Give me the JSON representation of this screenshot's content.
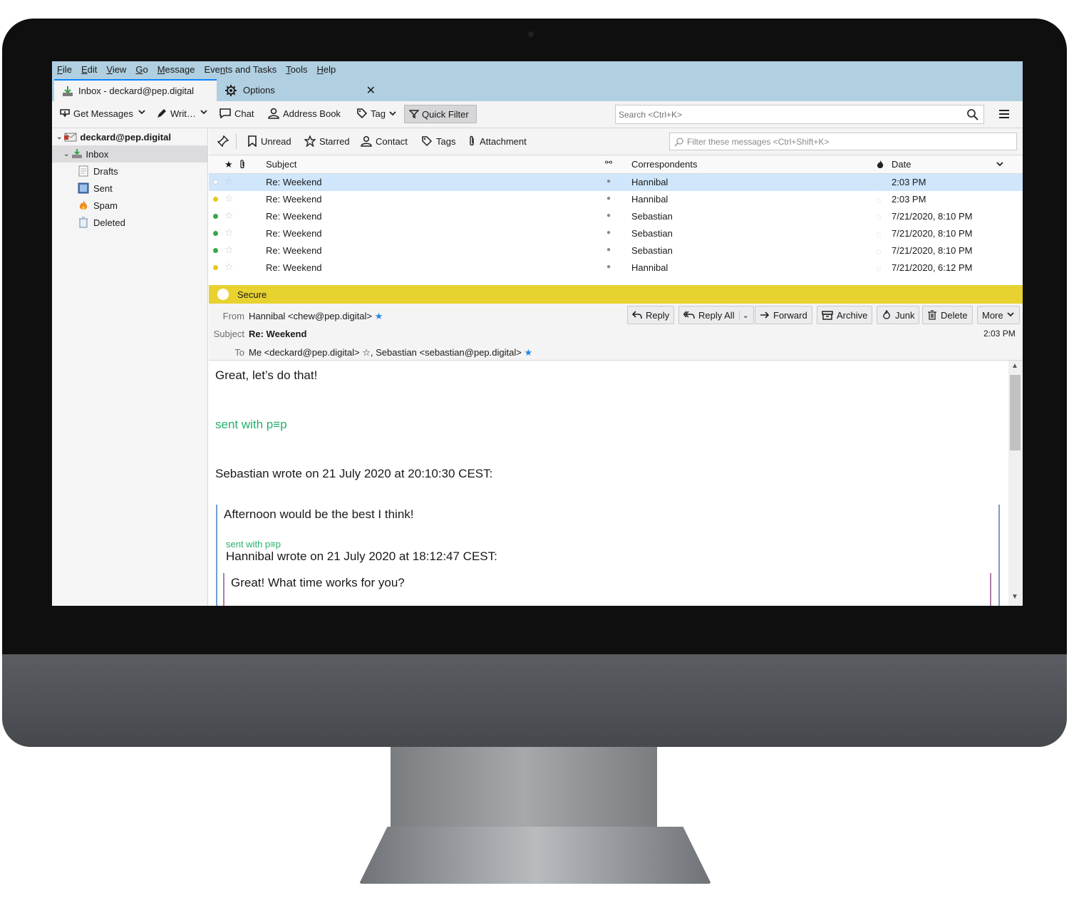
{
  "menu": [
    "File",
    "Edit",
    "View",
    "Go",
    "Message",
    "Events and Tasks",
    "Tools",
    "Help"
  ],
  "menu_access_letters": [
    "F",
    "E",
    "V",
    "G",
    "M",
    "n",
    "T",
    "H"
  ],
  "tabs": [
    {
      "label": "Inbox - deckard@pep.digital",
      "icon": "inbox-download-icon",
      "active": true
    },
    {
      "label": "Options",
      "icon": "gear-icon",
      "active": false
    }
  ],
  "toolbar": {
    "get_messages": "Get Messages",
    "write": "Writ…",
    "chat": "Chat",
    "address_book": "Address Book",
    "tag": "Tag",
    "quick_filter": "Quick Filter",
    "search_placeholder": "Search <Ctrl+K>"
  },
  "folders": {
    "account": "deckard@pep.digital",
    "items": [
      "Inbox",
      "Drafts",
      "Sent",
      "Spam",
      "Deleted"
    ]
  },
  "quick_filter_bar": {
    "unread": "Unread",
    "starred": "Starred",
    "contact": "Contact",
    "tags": "Tags",
    "attachment": "Attachment",
    "filter_placeholder": "Filter these messages <Ctrl+Shift+K>"
  },
  "columns": {
    "subject": "Subject",
    "correspondents": "Correspondents",
    "date": "Date"
  },
  "messages": [
    {
      "subject": "Re: Weekend",
      "correspondent": "Hannibal",
      "date": "2:03 PM",
      "status": "#ffffff",
      "selected": true
    },
    {
      "subject": "Re: Weekend",
      "correspondent": "Hannibal",
      "date": "2:03 PM",
      "status": "#e8c818"
    },
    {
      "subject": "Re: Weekend",
      "correspondent": "Sebastian",
      "date": "7/21/2020, 8:10 PM",
      "status": "#3aa54a"
    },
    {
      "subject": "Re: Weekend",
      "correspondent": "Sebastian",
      "date": "7/21/2020, 8:10 PM",
      "status": "#3aa54a"
    },
    {
      "subject": "Re: Weekend",
      "correspondent": "Sebastian",
      "date": "7/21/2020, 8:10 PM",
      "status": "#3aa54a"
    },
    {
      "subject": "Re: Weekend",
      "correspondent": "Hannibal",
      "date": "7/21/2020, 6:12 PM",
      "status": "#e8c818"
    }
  ],
  "security": {
    "label": "Secure",
    "color": "#e8d22f"
  },
  "header": {
    "from_label": "From",
    "from_value": "Hannibal <chew@pep.digital>",
    "subject_label": "Subject",
    "subject_value": "Re: Weekend",
    "to_label": "To",
    "to_me": "Me <deckard@pep.digital>",
    "to_other": "Sebastian <sebastian@pep.digital>",
    "time": "2:03 PM",
    "buttons": {
      "reply": "Reply",
      "reply_all": "Reply All",
      "forward": "Forward",
      "archive": "Archive",
      "junk": "Junk",
      "delete": "Delete",
      "more": "More"
    }
  },
  "body": {
    "line1": "Great, let’s do that!",
    "sig": "sent with p≡p",
    "wrote1": "Sebastian wrote on 21 July 2020 at 20:10:30 CEST:",
    "quote1": "Afternoon would be the best I think!",
    "sig2": "sent with p≡p",
    "wrote2": "Hannibal wrote on 21 July 2020 at 18:12:47 CEST:",
    "quote2": "Great! What time works for you?"
  }
}
